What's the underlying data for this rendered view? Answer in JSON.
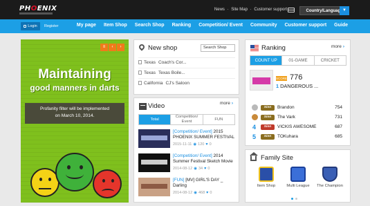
{
  "header": {
    "logo_text": "PHOENIX",
    "links": [
      "News",
      "Site Map",
      "Customer support"
    ],
    "country_button": "Country/Language"
  },
  "nav": {
    "login": "Login",
    "register": "Register",
    "items": [
      "My page",
      "Item Shop",
      "Search Shop",
      "Ranking",
      "Competition/ Event",
      "Community",
      "Customer support",
      "Guide"
    ]
  },
  "banner": {
    "headline1": "Maintaining",
    "headline2": "good manners in darts",
    "notice_line1": "Profanity filter will be implemented",
    "notice_line2": "on March 10, 2014."
  },
  "new_shop": {
    "title": "New shop",
    "search_button": "Search Shop",
    "rows": [
      {
        "location": "Texas",
        "name": "Coach's Cor..."
      },
      {
        "location": "Texas",
        "name": "Texas Boile..."
      },
      {
        "location": "California",
        "name": "CJ's Saloon"
      }
    ]
  },
  "video": {
    "title": "Video",
    "more": "more",
    "tabs": [
      "Total",
      "Competition/ Event",
      "FUN"
    ],
    "items": [
      {
        "tag": "[Competition/ Event]",
        "title": "2015 PHOENIX SUMMER FESTIVAL",
        "date": "2015-11-11",
        "views": "120",
        "likes": "0"
      },
      {
        "tag": "[Competition/ Event]",
        "title": "2014 Summer Festival Sketch Movie",
        "date": "2014-08-12",
        "views": "34",
        "likes": "0"
      },
      {
        "tag": "[FUN]",
        "title": "[MV] GIRL'S DAY _ Darling",
        "date": "2014-08-12",
        "views": "468",
        "likes": "0"
      }
    ]
  },
  "ranking": {
    "title": "Ranking",
    "more": "more",
    "tabs": [
      "COUNT UP",
      "01-GAME",
      "CRICKET"
    ],
    "first": {
      "rank": "1",
      "name": "DANGEROUS ...",
      "score": "776",
      "badge": "SCORE"
    },
    "rows": [
      {
        "rank": "2",
        "name": "Brandon",
        "score": "754",
        "chip": "Sinn"
      },
      {
        "rank": "3",
        "name": "The Vark",
        "score": "731",
        "chip": "Sinn"
      },
      {
        "rank": "4",
        "name": "VICKIS AWESOME",
        "score": "687",
        "chip": "Sinn"
      },
      {
        "rank": "5",
        "name": "TOKuhara",
        "score": "685",
        "chip": "Sinn"
      }
    ]
  },
  "family": {
    "title": "Family Site",
    "items": [
      "Item Shop",
      "Multi League",
      "The Champion"
    ]
  },
  "colors": {
    "nav_blue": "#1c9fe5",
    "banner_green": "#7fc01d",
    "accent_orange": "#f07a1a"
  }
}
